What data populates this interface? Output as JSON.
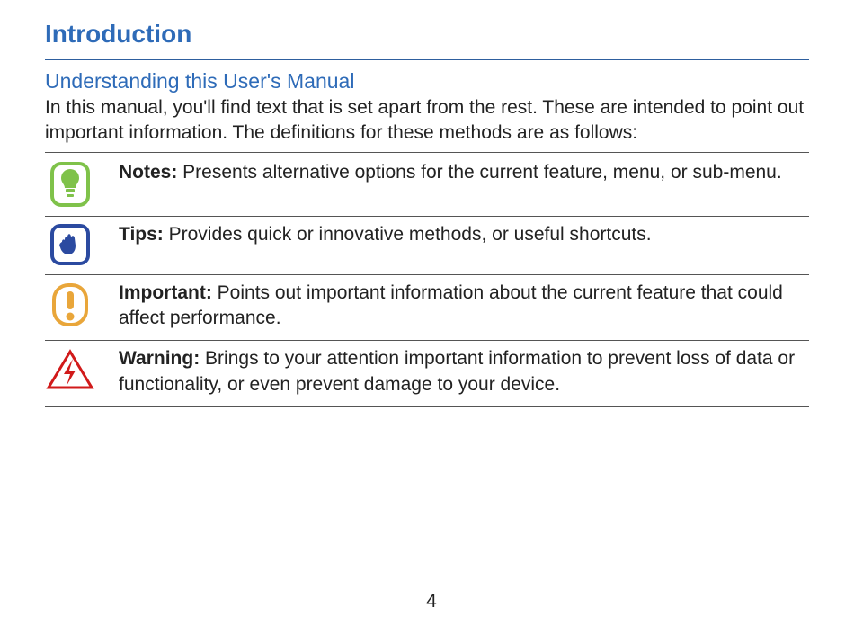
{
  "heading": "Introduction",
  "subheading": "Understanding this User's Manual",
  "intro": "In this manual, you'll find text that is set apart from the rest. These are intended to point out important information. The definitions for these methods are as follows:",
  "rows": {
    "notes": {
      "label": "Notes:",
      "text": " Presents alternative options for the current feature, menu, or sub-menu."
    },
    "tips": {
      "label": "Tips:",
      "text": " Provides quick or innovative methods, or useful shortcuts."
    },
    "important": {
      "label": "Important:",
      "text": " Points out important information about the current feature that could affect performance."
    },
    "warning": {
      "label": "Warning:",
      "text": " Brings to your attention important information to prevent loss of data or functionality, or even prevent damage to your device."
    }
  },
  "page_number": "4",
  "icons": {
    "notes": "lightbulb-icon",
    "tips": "hand-icon",
    "important": "exclaim-icon",
    "warning": "lightning-triangle-icon"
  }
}
